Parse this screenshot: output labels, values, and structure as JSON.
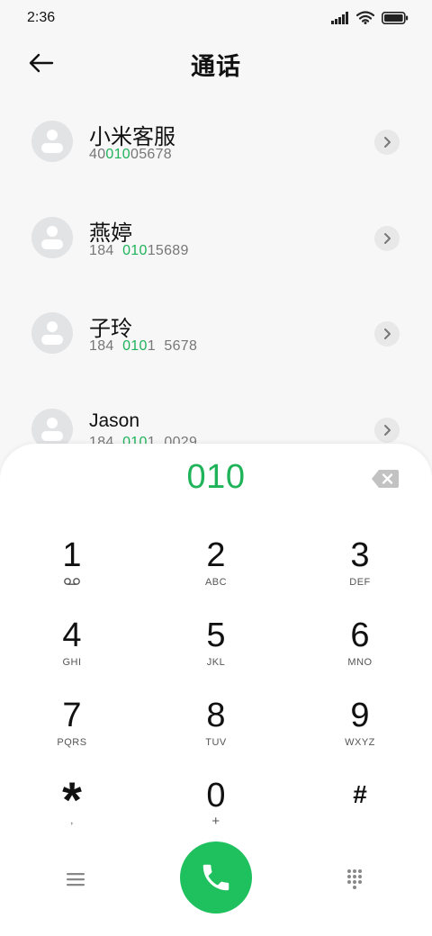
{
  "status_bar": {
    "time": "2:36"
  },
  "header": {
    "title": "通话"
  },
  "contacts": [
    {
      "name": "小米客服",
      "number_pre": "40",
      "number_match": "010",
      "number_post": "05678"
    },
    {
      "name": "燕婷",
      "number_pre": "184  ",
      "number_match": "010",
      "number_post": "15689"
    },
    {
      "name": "子玲",
      "number_pre": "184  ",
      "number_match": "010",
      "number_post": "1  5678"
    },
    {
      "name": "Jason",
      "number_pre": "184  ",
      "number_match": "010",
      "number_post": "1  0029"
    }
  ],
  "dialpad": {
    "input": "010",
    "keys": [
      {
        "digit": "1",
        "letters": "",
        "icon": "voicemail-icon"
      },
      {
        "digit": "2",
        "letters": "ABC"
      },
      {
        "digit": "3",
        "letters": "DEF"
      },
      {
        "digit": "4",
        "letters": "GHI"
      },
      {
        "digit": "5",
        "letters": "JKL"
      },
      {
        "digit": "6",
        "letters": "MNO"
      },
      {
        "digit": "7",
        "letters": "PQRS"
      },
      {
        "digit": "8",
        "letters": "TUV"
      },
      {
        "digit": "9",
        "letters": "WXYZ"
      },
      {
        "digit": "*",
        "letters": ","
      },
      {
        "digit": "0",
        "letters": "+"
      },
      {
        "digit": "#",
        "letters": ""
      }
    ]
  },
  "colors": {
    "accent": "#1fb35a",
    "call_button": "#1fc15f"
  },
  "icons": {
    "back": "arrow-left-icon",
    "chevron": "chevron-right-icon",
    "delete": "backspace-icon",
    "menu": "menu-icon",
    "call": "phone-icon",
    "keypad": "keypad-icon"
  }
}
